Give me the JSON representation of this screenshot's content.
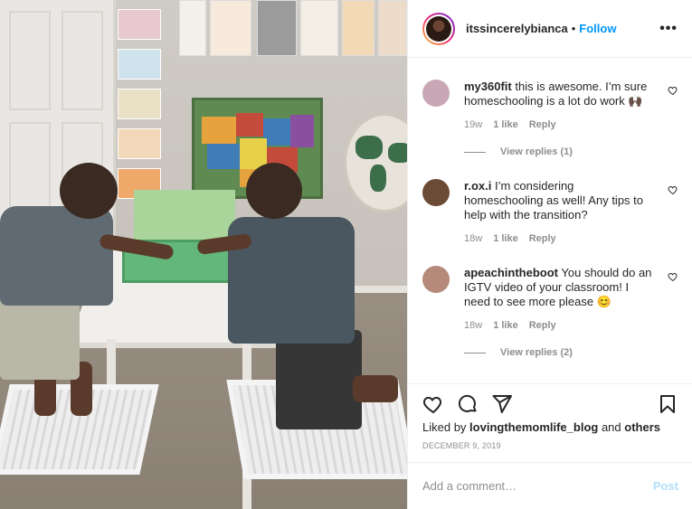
{
  "post": {
    "username": "itssincerelybianca",
    "separator": "•",
    "follow_label": "Follow",
    "more_label": "•••"
  },
  "comments": [
    {
      "username": "my360fit",
      "text": "this is awesome. I’m sure homeschooling is a lot do work 🙌🏿",
      "age": "19w",
      "likes": "1 like",
      "reply_label": "Reply",
      "view_replies": "View replies (1)",
      "avatar_color": "#c9a7b5"
    },
    {
      "username": "r.ox.i",
      "text": "I’m considering homeschooling as well! Any tips to help with the transition?",
      "age": "18w",
      "likes": "1 like",
      "reply_label": "Reply",
      "view_replies": "",
      "avatar_color": "#6b4a36"
    },
    {
      "username": "apeachintheboot",
      "text": "You should do an IGTV video of your classroom! I need to see more please 😊",
      "age": "18w",
      "likes": "1 like",
      "reply_label": "Reply",
      "view_replies": "View replies (2)",
      "avatar_color": "#b58a7a"
    }
  ],
  "likes_summary": {
    "prefix": "Liked by ",
    "user": "lovingthemomlife_blog",
    "middle": " and ",
    "others": "others"
  },
  "date": "DECEMBER 9, 2019",
  "add_comment": {
    "placeholder": "Add a comment…",
    "post_label": "Post"
  },
  "icons": {
    "like": "heart-icon",
    "comment": "comment-icon",
    "share": "share-icon",
    "save": "bookmark-icon",
    "more": "more-options-icon"
  },
  "colors": {
    "accent": "#0095f6",
    "post_disabled": "#b2dffc",
    "muted": "#8e8e8e",
    "text": "#262626"
  }
}
